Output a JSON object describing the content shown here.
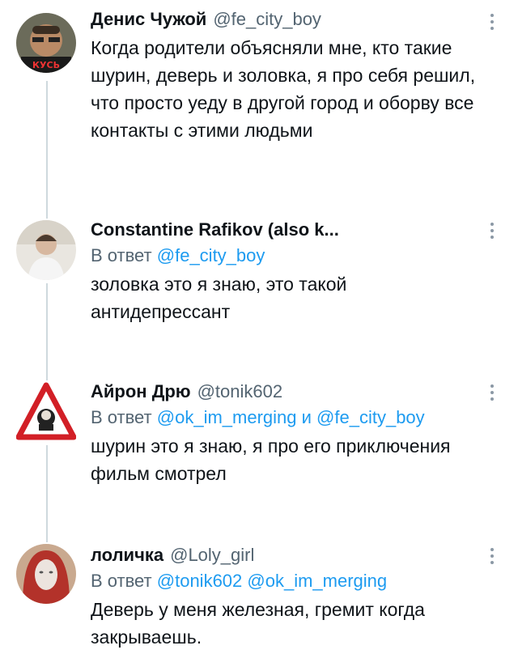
{
  "tweets": [
    {
      "name": "Денис Чужой",
      "handle": "@fe_city_boy",
      "avatar_text": "КУСЬ",
      "text": "Когда родители объясняли мне, кто такие шурин, деверь и золовка, я про себя решил, что просто уеду в другой город и оборву все контакты с этими людьми"
    },
    {
      "name": "Constantine Rafikov (also k...",
      "reply_prefix": "В ответ",
      "reply_mentions": "@fe_city_boy",
      "text": "золовка это я знаю, это такой антидепрессант"
    },
    {
      "name": "Айрон Дрю",
      "handle": "@tonik602",
      "reply_prefix": "В ответ",
      "reply_mention1": "@ok_im_merging",
      "reply_and": "и",
      "reply_mention2": "@fe_city_boy",
      "text": "шурин это я знаю, я про его приключения фильм смотрел"
    },
    {
      "name": "лоличка",
      "handle": "@Loly_girl",
      "reply_prefix": "В ответ",
      "reply_mentions": "@tonik602 @ok_im_merging",
      "text": "Деверь у меня железная, гремит когда закрываешь."
    }
  ],
  "colors": {
    "mention": "#1d9bf0",
    "secondary": "#536471",
    "thread_line": "#cfd9de"
  }
}
